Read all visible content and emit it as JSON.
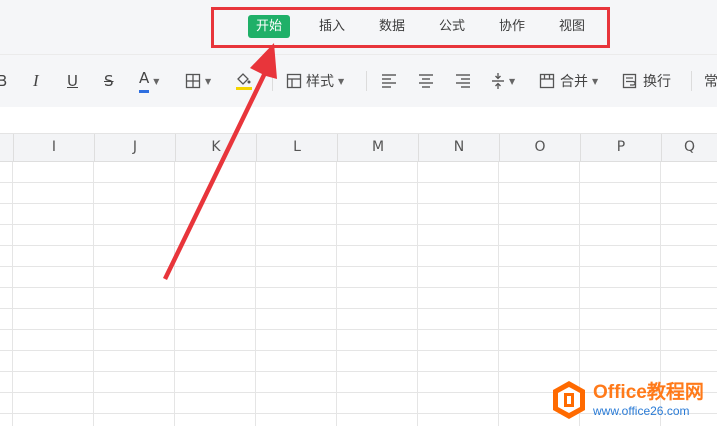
{
  "tabs": [
    {
      "label": "开始",
      "active": true
    },
    {
      "label": "插入",
      "active": false
    },
    {
      "label": "数据",
      "active": false
    },
    {
      "label": "公式",
      "active": false
    },
    {
      "label": "协作",
      "active": false
    },
    {
      "label": "视图",
      "active": false
    }
  ],
  "toolbar": {
    "bold": "B",
    "italic": "I",
    "underline": "U",
    "strike": "S",
    "font_color": "A",
    "style_label": "样式",
    "merge_label": "合并",
    "wrap_label": "换行",
    "more_label": "常"
  },
  "columns": [
    "I",
    "J",
    "K",
    "L",
    "M",
    "N",
    "O",
    "P",
    "Q"
  ],
  "watermark": {
    "title": "Office教程网",
    "url": "www.office26.com"
  },
  "colors": {
    "active_tab": "#1fb068",
    "highlight_red": "#e8353b",
    "watermark_orange": "#ff7a1a",
    "watermark_blue": "#2a7bd6",
    "font_color_bar": "#2f6fe0",
    "fill_color_bar": "#f5d400"
  }
}
